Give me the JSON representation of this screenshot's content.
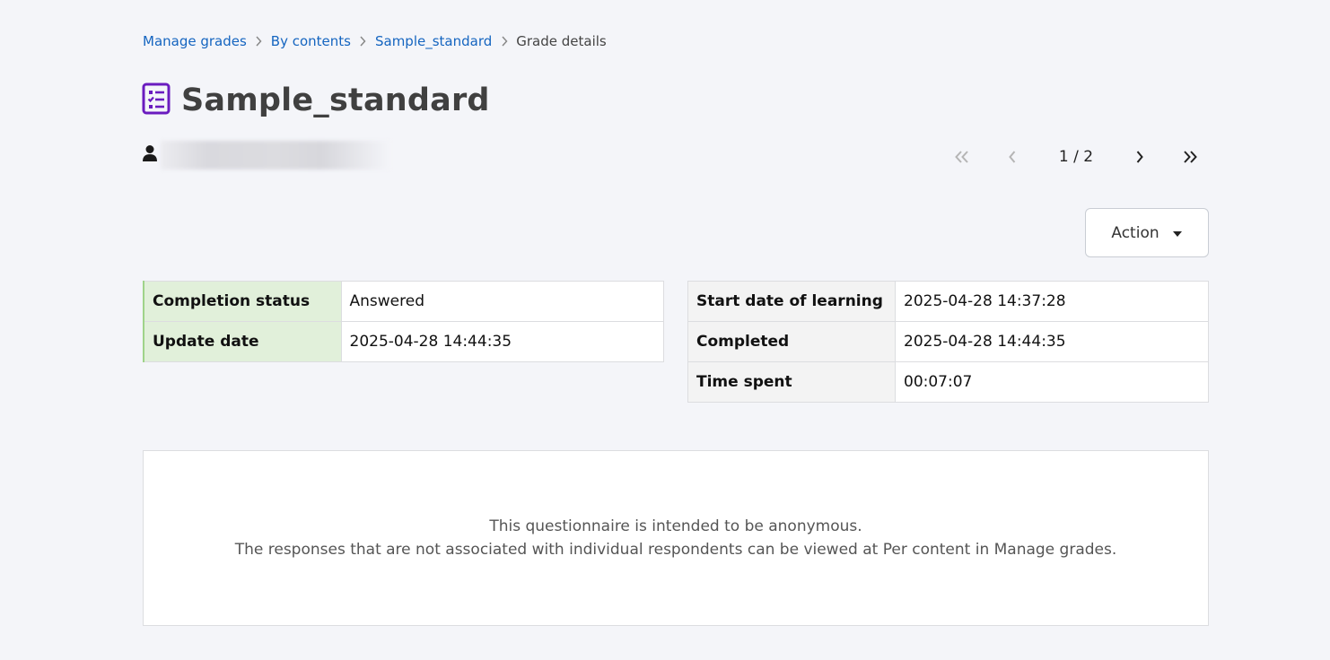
{
  "breadcrumb": {
    "items": [
      "Manage grades",
      "By contents",
      "Sample_standard"
    ],
    "current": "Grade details"
  },
  "title": "Sample_standard",
  "title_icon": "questionnaire-icon",
  "user": {
    "icon": "user-icon",
    "name": ""
  },
  "pagination": {
    "current": 1,
    "total": 2,
    "display": "1 / 2"
  },
  "action_button": {
    "label": "Action",
    "icon": "caret-down-icon"
  },
  "status_table": [
    {
      "label": "Completion status",
      "value": "Answered"
    },
    {
      "label": "Update date",
      "value": "2025-04-28 14:44:35"
    }
  ],
  "time_table": [
    {
      "label": "Start date of learning",
      "value": "2025-04-28 14:37:28"
    },
    {
      "label": "Completed",
      "value": "2025-04-28 14:44:35"
    },
    {
      "label": "Time spent",
      "value": "00:07:07"
    }
  ],
  "notice": {
    "line1": "This questionnaire is intended to be anonymous.",
    "line2": "The responses that are not associated with individual respondents can be viewed at Per content in Manage grades."
  },
  "colors": {
    "link": "#1565c0",
    "icon_accent": "#6a1bbf",
    "status_label_bg": "#e1f0da",
    "status_label_border": "#9fd38a",
    "page_bg": "#f4f5f9"
  }
}
